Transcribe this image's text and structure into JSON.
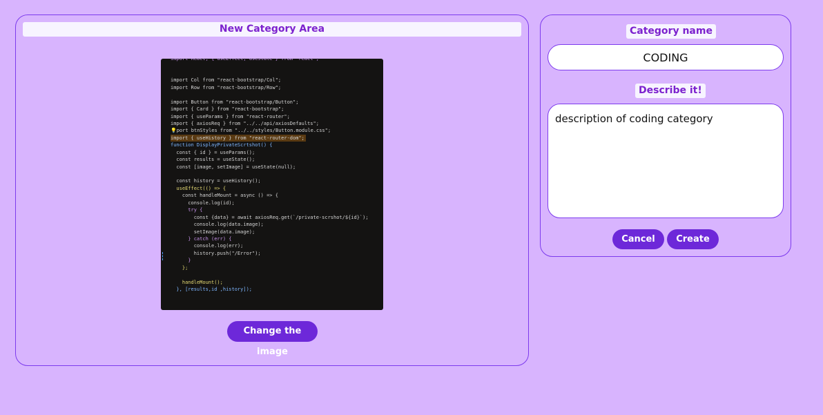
{
  "new_category_area": {
    "title": "New Category Area",
    "change_image_label": "Change the image",
    "code_image": {
      "lines": [
        {
          "t": "import React, { useEffect, useState } from \"react\";",
          "c": "#c792ea",
          "hl": false
        },
        {
          "t": "",
          "c": "#d4d4d4",
          "hl": false
        },
        {
          "t": "",
          "c": "#d4d4d4",
          "hl": false
        },
        {
          "t": "import Col from \"react-bootstrap/Col\";",
          "c": "#d4d4d4",
          "hl": false
        },
        {
          "t": "import Row from \"react-bootstrap/Row\";",
          "c": "#d4d4d4",
          "hl": false
        },
        {
          "t": "",
          "c": "#d4d4d4",
          "hl": false
        },
        {
          "t": "import Button from \"react-bootstrap/Button\";",
          "c": "#d4d4d4",
          "hl": false
        },
        {
          "t": "import { Card } from \"react-bootstrap\";",
          "c": "#d4d4d4",
          "hl": false
        },
        {
          "t": "import { useParams } from \"react-router\";",
          "c": "#d4d4d4",
          "hl": false
        },
        {
          "t": "import { axiosReq } from \"../../api/axiosDefaults\";",
          "c": "#d4d4d4",
          "hl": false
        },
        {
          "t": "💡port btnStyles from \"../../styles/Button.module.css\";",
          "c": "#d4d4d4",
          "hl": false
        },
        {
          "t": "import { useHistory } from \"react-router-dom\";",
          "c": "#d4d4d4",
          "hl": true
        },
        {
          "t": "function DisplayPrivateScrtshot() {",
          "c": "#7fb7ff",
          "hl": false
        },
        {
          "t": "  const { id } = useParams();",
          "c": "#d4d4d4",
          "hl": false
        },
        {
          "t": "  const results = useState();",
          "c": "#d4d4d4",
          "hl": false
        },
        {
          "t": "  const [image, setImage] = useState(null);",
          "c": "#d4d4d4",
          "hl": false
        },
        {
          "t": "",
          "c": "#d4d4d4",
          "hl": false
        },
        {
          "t": "  const history = useHistory();",
          "c": "#d4d4d4",
          "hl": false
        },
        {
          "t": "  useEffect(() => {",
          "c": "#e6db74",
          "hl": false
        },
        {
          "t": "    const handleMount = async () => {",
          "c": "#d4d4d4",
          "hl": false
        },
        {
          "t": "      console.log(id);",
          "c": "#d4d4d4",
          "hl": false
        },
        {
          "t": "      try {",
          "c": "#c792ea",
          "hl": false
        },
        {
          "t": "        const {data} = await axiosReq.get(`/private-scrshot/${id}`);",
          "c": "#d4d4d4",
          "hl": false
        },
        {
          "t": "        console.log(data.image);",
          "c": "#d4d4d4",
          "hl": false
        },
        {
          "t": "        setImage(data.image);",
          "c": "#d4d4d4",
          "hl": false
        },
        {
          "t": "      } catch (err) {",
          "c": "#c792ea",
          "hl": false
        },
        {
          "t": "        console.log(err);",
          "c": "#d4d4d4",
          "hl": false
        },
        {
          "t": "        history.push(\"/Error\");",
          "c": "#d4d4d4",
          "hl": false
        },
        {
          "t": "      }",
          "c": "#c792ea",
          "hl": false
        },
        {
          "t": "    };",
          "c": "#e6db74",
          "hl": false
        },
        {
          "t": "",
          "c": "#d4d4d4",
          "hl": false
        },
        {
          "t": "    handleMount();",
          "c": "#e6db74",
          "hl": false
        },
        {
          "t": "  }, [results,id ,history]);",
          "c": "#7fb7ff",
          "hl": false
        }
      ]
    }
  },
  "form": {
    "name_label": "Category name",
    "name_value": "CODING",
    "describe_label": "Describe it!",
    "description_value": "description of coding category",
    "cancel_label": "Cancel",
    "create_label": "Create"
  },
  "colors": {
    "background": "#d8b4fe",
    "accent": "#6d28d9",
    "label_text": "#7c22ce"
  }
}
